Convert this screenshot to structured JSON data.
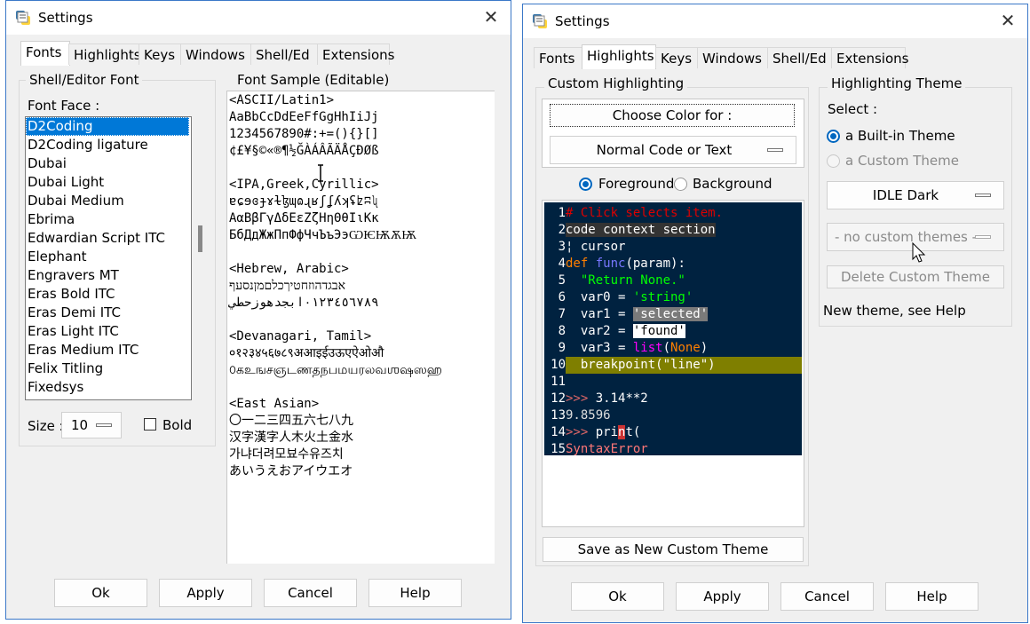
{
  "window_a": {
    "title": "Settings",
    "tabs": [
      "Fonts",
      "Highlights",
      "Keys",
      "Windows",
      "Shell/Ed",
      "Extensions"
    ],
    "active_tab": "Fonts",
    "shell_editor_font": {
      "legend": "Shell/Editor Font",
      "font_face_label": "Font Face :",
      "fonts": [
        "D2Coding",
        "D2Coding ligature",
        "Dubai",
        "Dubai Light",
        "Dubai Medium",
        "Ebrima",
        "Edwardian Script ITC",
        "Elephant",
        "Engravers MT",
        "Eras Bold ITC",
        "Eras Demi ITC",
        "Eras Light ITC",
        "Eras Medium ITC",
        "Felix Titling",
        "Fixedsys"
      ],
      "selected_font": "D2Coding",
      "size_label": "Size :",
      "size_value": "10",
      "bold_label": "Bold",
      "bold_checked": false
    },
    "font_sample": {
      "legend": "Font Sample (Editable)",
      "lines": [
        "<ASCII/Latin1>",
        "AaBbCcDdEeFfGgHhIiJj",
        "1234567890#:+=(){}[]",
        "¢£¥§©«®¶½ĞÀÁÂÃÄÅÇÐØß",
        "",
        "<IPA,Greek,Cyrillic>",
        "ɐɕɘɞɟɤɫɮɰɷɻʁʃʆʎʞʢʫʭʯ",
        "ΑαΒβΓγΔδΕεΖζΗηΘθΙιΚκ",
        "БбДдЖжПпФфЧчЪъЭэѠѤѬѪѬ",
        "",
        "<Hebrew, Arabic>",
        "אבגדהוזחטיךכלםמןנסעף",
        "٠١٢٣٤٥٦٧٨٩ابجدهوزحطي",
        "",
        "<Devanagari, Tamil>",
        "०१२३४५६७८९अआइईउऊएऐओऔ",
        "௦கஉஙசஞடணதநபமயரலவஶஷஸஹ",
        "",
        "<East Asian>",
        "〇一二三四五六七八九",
        "汉字漢字人木火土金水",
        "가냐더려모뵤수유즈치",
        "あいうえおアイウエオ"
      ]
    },
    "buttons": [
      "Ok",
      "Apply",
      "Cancel",
      "Help"
    ]
  },
  "window_b": {
    "title": "Settings",
    "tabs": [
      "Fonts",
      "Highlights",
      "Keys",
      "Windows",
      "Shell/Ed",
      "Extensions"
    ],
    "active_tab": "Highlights",
    "custom_highlighting": {
      "legend": "Custom Highlighting",
      "choose_color_label": "Choose Color for :",
      "element_value": "Normal Code or Text",
      "foreground_label": "Foreground",
      "background_label": "Background",
      "foreground_selected": true,
      "code_lines": [
        {
          "n": "1",
          "text": "# Click selects item."
        },
        {
          "n": "2",
          "text": "code context section"
        },
        {
          "n": "3",
          "text": "¦ cursor"
        },
        {
          "n": "4",
          "text": "def func(param):"
        },
        {
          "n": "5",
          "text": "  \"Return None.\""
        },
        {
          "n": "6",
          "text": "  var0 = 'string'"
        },
        {
          "n": "7",
          "text": "  var1 = 'selected'"
        },
        {
          "n": "8",
          "text": "  var2 = 'found'"
        },
        {
          "n": "9",
          "text": "  var3 = list(None)"
        },
        {
          "n": "10",
          "text": "  breakpoint(\"line\")"
        },
        {
          "n": "11",
          "text": ""
        },
        {
          "n": "12",
          "text": ">>> 3.14**2"
        },
        {
          "n": "13",
          "text": "9.8596"
        },
        {
          "n": "14",
          "text": ">>> print("
        },
        {
          "n": "15",
          "text": "SyntaxError"
        }
      ],
      "save_button": "Save as New Custom Theme"
    },
    "highlighting_theme": {
      "legend": "Highlighting Theme",
      "select_label": "Select :",
      "builtin_label": "a Built-in Theme",
      "custom_label": "a Custom Theme",
      "builtin_selected": true,
      "builtin_value": "IDLE Dark",
      "custom_value": "- no custom themes -",
      "delete_button": "Delete Custom Theme",
      "help_text": "New theme, see Help"
    },
    "buttons": [
      "Ok",
      "Apply",
      "Cancel",
      "Help"
    ]
  },
  "colors": {
    "code_bg": "#002240",
    "selection_blue": "#0078d7",
    "radio_blue": "#0067c0",
    "window_border": "#3b78c8"
  }
}
